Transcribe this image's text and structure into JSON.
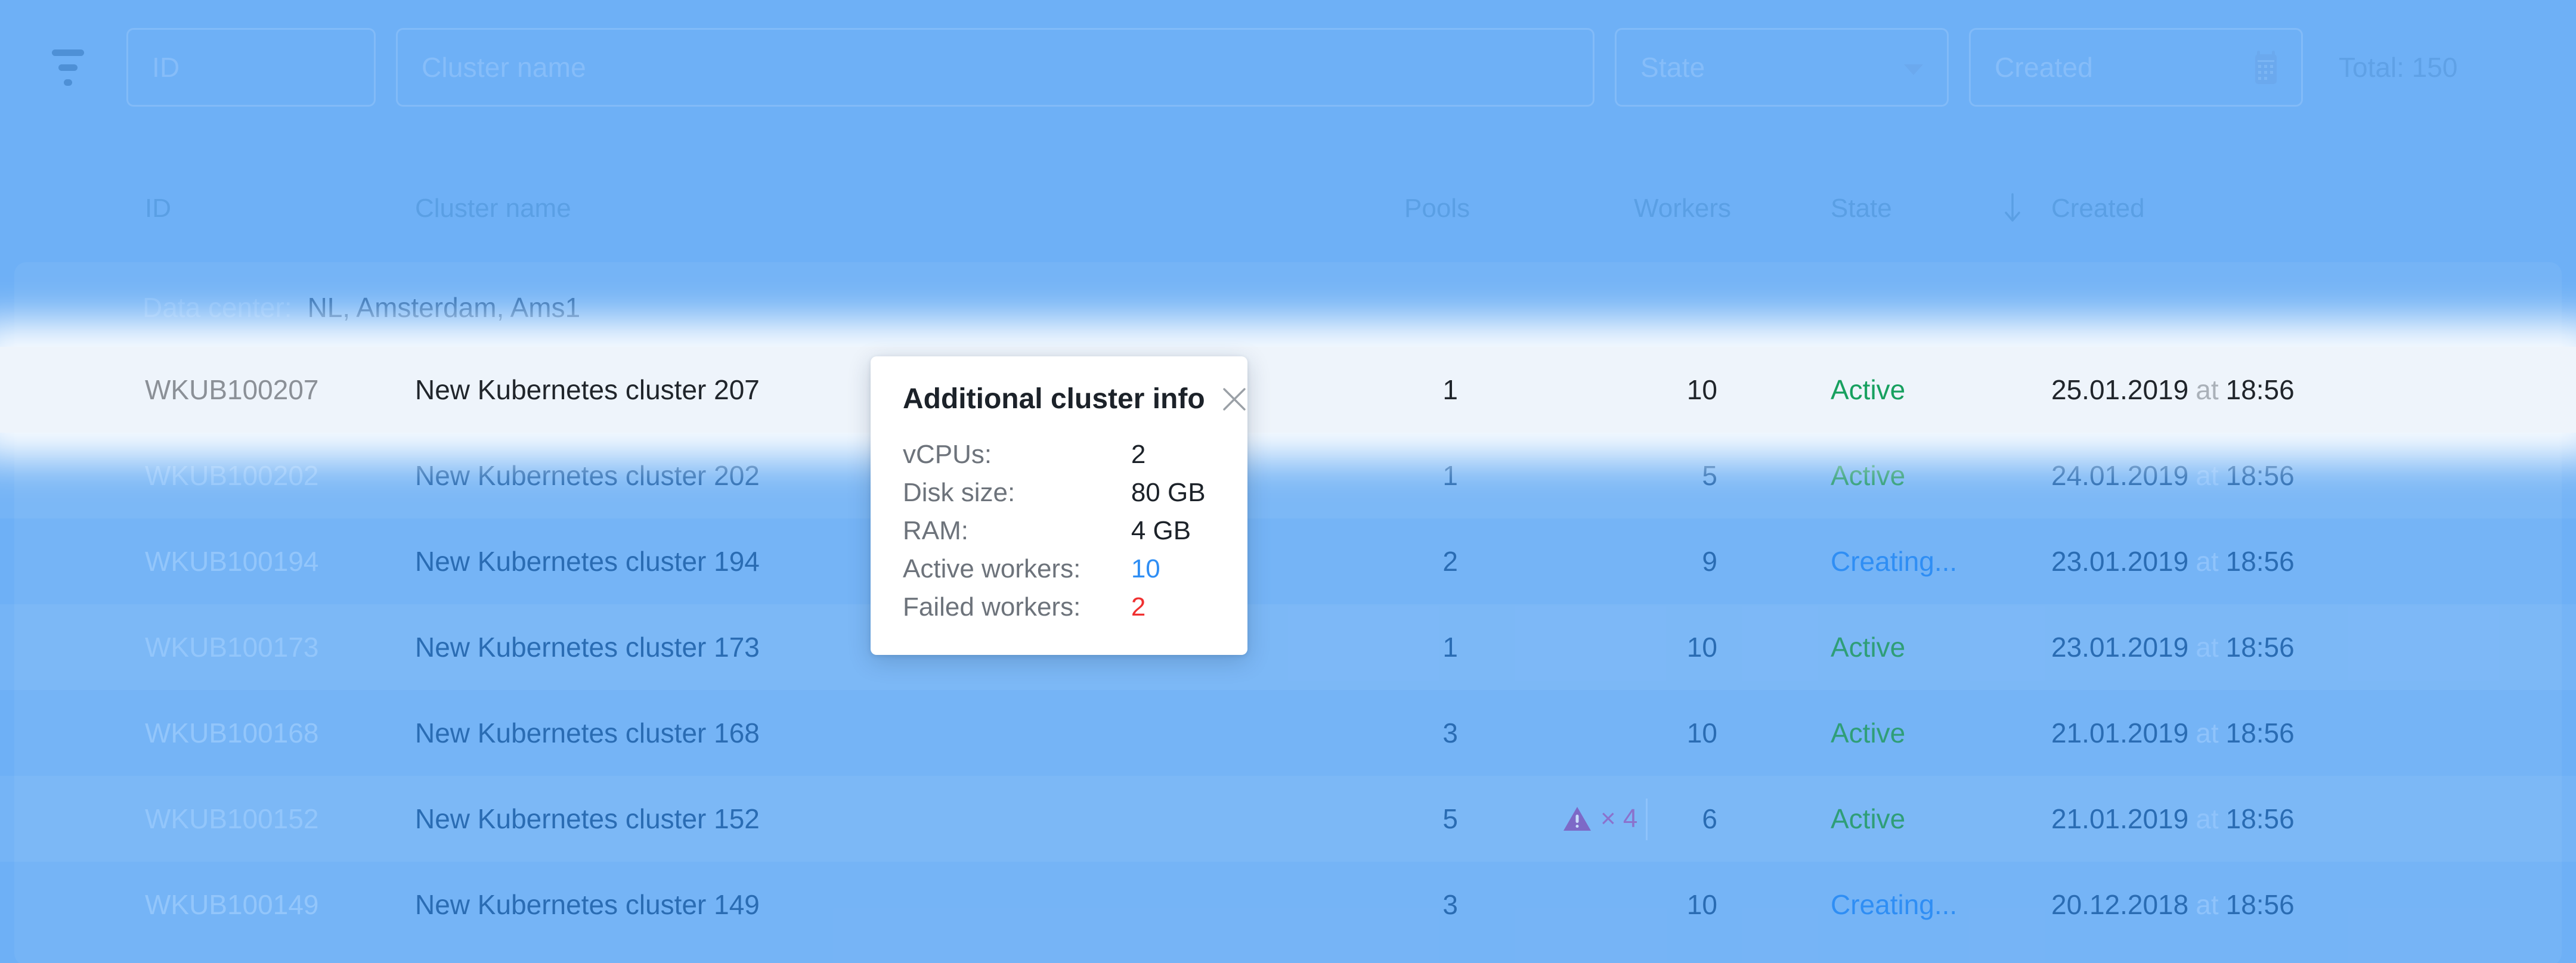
{
  "toolbar": {
    "filter_icon": "filter-icon",
    "id_placeholder": "ID",
    "name_placeholder": "Cluster name",
    "state_placeholder": "State",
    "state_caret_icon": "chevron-down-icon",
    "created_placeholder": "Created",
    "created_calendar_icon": "calendar-icon",
    "total_label": "Total: 150"
  },
  "table": {
    "headers": {
      "id": "ID",
      "name": "Cluster name",
      "pools": "Pools",
      "workers": "Workers",
      "state": "State",
      "created": "Created",
      "sort_icon": "arrow-down-icon"
    },
    "group": {
      "label": "Data center:",
      "value": "NL, Amsterdam, Ams1"
    },
    "rows": [
      {
        "id": "WKUB100207",
        "name": "New Kubernetes cluster 207",
        "pools": "1",
        "warning": null,
        "workers": "10",
        "state": "Active",
        "state_kind": "active",
        "date": "25.01.2019",
        "at": "at",
        "time": "18:56",
        "highlighted": true
      },
      {
        "id": "WKUB100202",
        "name": "New Kubernetes cluster 202",
        "pools": "1",
        "warning": null,
        "workers": "5",
        "state": "Active",
        "state_kind": "active",
        "date": "24.01.2019",
        "at": "at",
        "time": "18:56",
        "highlighted": false
      },
      {
        "id": "WKUB100194",
        "name": "New Kubernetes cluster 194",
        "pools": "2",
        "warning": null,
        "workers": "9",
        "state": "Creating...",
        "state_kind": "creating",
        "date": "23.01.2019",
        "at": "at",
        "time": "18:56",
        "highlighted": false
      },
      {
        "id": "WKUB100173",
        "name": "New Kubernetes cluster 173",
        "pools": "1",
        "warning": null,
        "workers": "10",
        "state": "Active",
        "state_kind": "active",
        "date": "23.01.2019",
        "at": "at",
        "time": "18:56",
        "highlighted": false
      },
      {
        "id": "WKUB100168",
        "name": "New Kubernetes cluster 168",
        "pools": "3",
        "warning": null,
        "workers": "10",
        "state": "Active",
        "state_kind": "active",
        "date": "21.01.2019",
        "at": "at",
        "time": "18:56",
        "highlighted": false
      },
      {
        "id": "WKUB100152",
        "name": "New Kubernetes cluster 152",
        "pools": "5",
        "warning": "× 4",
        "warning_icon": "warning-triangle-icon",
        "workers": "6",
        "state": "Active",
        "state_kind": "active",
        "date": "21.01.2019",
        "at": "at",
        "time": "18:56",
        "highlighted": false
      },
      {
        "id": "WKUB100149",
        "name": "New Kubernetes cluster 149",
        "pools": "3",
        "warning": null,
        "workers": "10",
        "state": "Creating...",
        "state_kind": "creating",
        "date": "20.12.2018",
        "at": "at",
        "time": "18:56",
        "highlighted": false
      }
    ]
  },
  "popover": {
    "title": "Additional cluster info",
    "close_icon": "close-icon",
    "items": [
      {
        "key": "vCPUs:",
        "value": "2",
        "tone": "dark"
      },
      {
        "key": "Disk size:",
        "value": "80 GB",
        "tone": "dark"
      },
      {
        "key": "RAM:",
        "value": "4 GB",
        "tone": "dark"
      },
      {
        "key": "Active workers:",
        "value": "10",
        "tone": "blue"
      },
      {
        "key": "Failed workers:",
        "value": "2",
        "tone": "red"
      }
    ]
  },
  "colors": {
    "page_bg": "#6eb0f6",
    "accent_blue": "#2f8ef4",
    "state_active_green": "#2f9e78",
    "failed_red": "#f03030",
    "warning_purple": "#7d69c7",
    "row_highlight_bg": "#eef4fb"
  }
}
